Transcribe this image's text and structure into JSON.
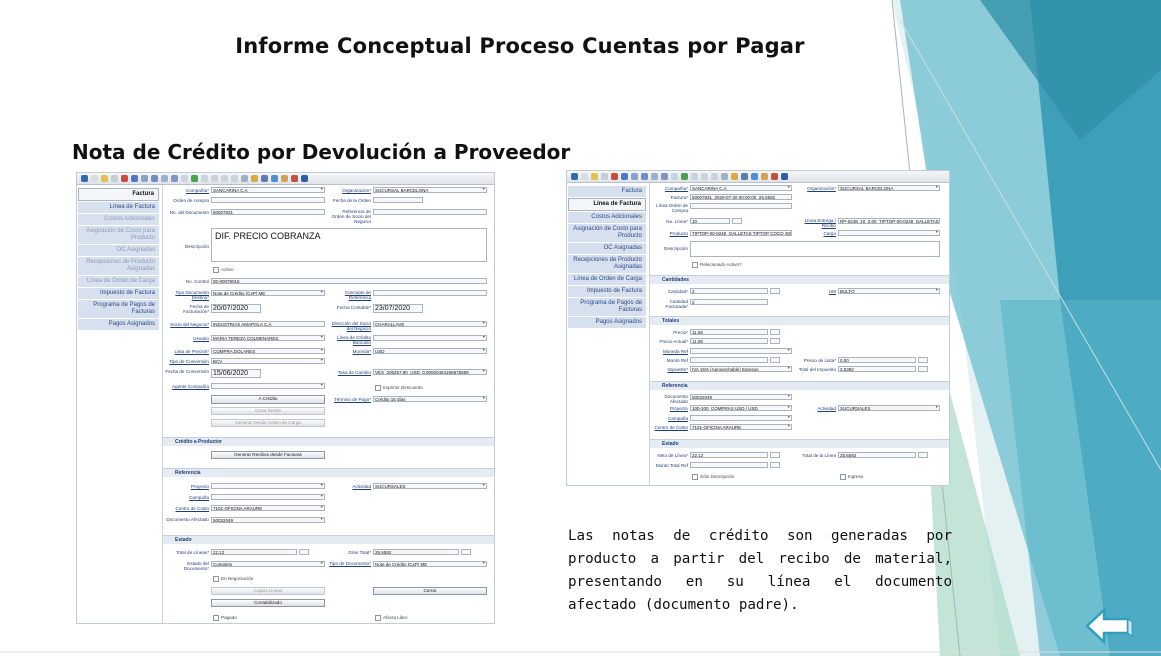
{
  "slide": {
    "title": "Informe Conceptual Proceso Cuentas por Pagar",
    "subtitle": "Nota de Crédito por Devolución a Proveedor",
    "description": "Las notas de crédito son generadas por producto a partir del recibo de material, presentando en su línea el documento afectado (documento padre).",
    "colors": {
      "teal_dark": "#2f8fa6",
      "teal_mid": "#4aa9bf",
      "teal_light": "#8fd0dc",
      "green_light": "#a9d8c6",
      "arrow": "#2f9fc0"
    },
    "back_icon": "left-arrow-icon"
  },
  "left_shot": {
    "sidebar": [
      "Factura",
      "Línea de Factura",
      "Costos Adicionales",
      "Asignación de Costo para Producto",
      "OC Asignadas",
      "Recepciones de Producto Asignadas",
      "Línea de Orden de Carga",
      "Impuesto de Factura",
      "Programa de Pagos de Facturas",
      "Pagos Asignados"
    ],
    "header": {
      "compania_label": "Compañía*",
      "compania": "SANCARINA C.A",
      "organizacion_label": "Organización*",
      "organizacion": "SUCURSAL BARCELONA",
      "orden_compra_label": "Orden de compra",
      "fecha_orden_label": "Fecha de la Orden",
      "no_documento_label": "No. del Documento",
      "no_documento": "50007931",
      "ref_orden_label": "Referencia de Orden de Socio del Negocio",
      "descripcion_label": "Descripción",
      "descripcion": "DIF. PRECIO COBRANZA",
      "activo_label": "Activo",
      "no_control_label": "No. Control",
      "no_control": "00-00079016",
      "tipo_doc_destino_label": "Tipo Documento Destino*",
      "tipo_doc_destino": "Nota de Crédito (CxP) ME",
      "concepto_ref_label": "Concepto de Referencia",
      "fecha_facturacion_label": "Fecha de Facturación*",
      "fecha_facturacion": "20/07/2020",
      "fecha_contable_label": "Fecha Contable*",
      "fecha_contable": "23/07/2020",
      "socio_label": "Socio del Negocio*",
      "socio": "INDUSTRIAS AMAPOLA C.A",
      "direccion_label": "Dirección del Socio del Negocio",
      "direccion": "CHARALLAVE",
      "usuario_label": "Usuario",
      "usuario": "MARIA TEREZA COLMENARES",
      "linea_credito_label": "Línea de Crédito Bancario",
      "lista_precios_label": "Lista de Precios*",
      "lista_precios": "COMPRA DOLARES",
      "moneda_label": "Moneda*",
      "moneda": "USD",
      "tipo_conversion_label": "Tipo de Conversión",
      "tipo_conversion": "BCV",
      "fecha_conversion_label": "Fecha de Conversión",
      "fecha_conversion": "15/06/2020",
      "tasa_cambio_label": "Tasa de Cambio",
      "tasa_cambio": "VES_206257.90_USD_0.00000484196876559",
      "imprimir_descuento_label": "Imprimir Descuento",
      "agente_label": "Agente Compañía",
      "a_credito_btn": "A Crédito",
      "termino_pago_label": "Término de Pago*",
      "termino_pago": "Crédito 15 días",
      "crear_desde_btn": "Crear Desde",
      "generar_desde_oc_btn": "Generar Desde Orden de Carga"
    },
    "credito_section": {
      "title": "Crédito a Productor",
      "btn": "Generar Recibos desde Facturas"
    },
    "referencia_section": {
      "title": "Referencia",
      "proyecto_label": "Proyecto",
      "actividad_label": "Actividad",
      "actividad": "SUCURSALES",
      "campana_label": "Campaña",
      "centro_costo_label": "Centro de Costo",
      "centro_costo": "7101-OFICINA ARAURE",
      "doc_afectado_label": "Documento Afectado",
      "doc_afectado": "50032049"
    },
    "estado_section": {
      "title": "Estado",
      "total_lineas_label": "Total de Líneas*",
      "total_lineas": "22,12",
      "gran_total_label": "Gran Total*",
      "gran_total": "25,6592",
      "estado_doc_label": "Estado del Documento*",
      "estado_doc": "Completo",
      "tipo_doc_label": "Tipo de Documento*",
      "tipo_doc": "Nota de Crédito (CxP) ME",
      "negociacion_label": "En Negociación",
      "copiar_lineas_btn": "Copiar Líneas",
      "cerrar_btn": "Cerrar",
      "contabilizado_btn": "Contabilizado",
      "pagado_label": "Pagado",
      "afecta_libro_label": "Afecta Libro"
    }
  },
  "right_shot": {
    "sidebar": [
      "Factura",
      "Línea de Factura",
      "Costos Adicionales",
      "Asignación de Costo para Producto",
      "OC Asignadas",
      "Recepciones de Producto Asignadas",
      "Línea de Orden de Carga",
      "Impuesto de Factura",
      "Programa de Pagos de Facturas",
      "Pagos Asignados"
    ],
    "header": {
      "compania_label": "Compañía*",
      "compania": "SANCARINA C.A",
      "organizacion_label": "Organización*",
      "organizacion": "SUCURSAL BARCELONA",
      "factura_label": "Factura*",
      "factura": "50007931_2020-07-20 00:00:00_25,6592",
      "linea_orden_label": "Línea Orden de Compra",
      "no_linea_label": "No. Línea*",
      "no_linea": "10",
      "linea_entrega_label": "Línea Entrega / Recibo",
      "linea_entrega": "RP-0248_10_2.00_TIPTOP-00-0248_GALLETAS TIP",
      "producto_label": "Producto",
      "producto": "TIPTOP-00-0248_GALLETAS TIPTOP COCO 48X60",
      "cargo_label": "Cargo",
      "descripcion_label": "Descripción",
      "relacionado_label": "Relacionado Activo?"
    },
    "cantidades": {
      "title": "Cantidades",
      "cantidad_label": "Cantidad*",
      "cantidad": "2",
      "um_label": "UM",
      "um": "BULTO",
      "cant_fact_label": "Cantidad Facturada*",
      "cant_fact": "2"
    },
    "totales": {
      "title": "Totales",
      "precio_label": "Precio*",
      "precio": "11,06",
      "precio_actual_label": "Precio Actual*",
      "precio_actual": "11,06",
      "moneda_ref_label": "Moneda Ref",
      "monto_ref_label": "Monto Ref",
      "precio_lista_label": "Precio de Lista*",
      "precio_lista": "0,00",
      "impuesto_label": "Impuesto*",
      "impuesto": "IVA 16% (Aprovechable) Egresos",
      "total_impuesto_label": "Total del Impuesto",
      "total_impuesto": "3,5392"
    },
    "referencia": {
      "title": "Referencia",
      "doc_afectado_label": "Documento Afectado",
      "doc_afectado": "50032049",
      "proyecto_label": "Proyecto",
      "proyecto": "100-100_COMPRAS USD / USD",
      "actividad_label": "Actividad",
      "actividad": "SUCURSALES",
      "campana_label": "Campaña",
      "centro_costo_label": "Centro de Costo",
      "centro_costo": "7101-OFICINA ARAURE"
    },
    "estado": {
      "title": "Estado",
      "neto_linea_label": "Neto de Línea*",
      "neto_linea": "22,12",
      "total_linea_label": "Total de la Línea",
      "total_linea": "25,6592",
      "monto_total_ref_label": "Monto Total Ref",
      "solo_desc_label": "Sólo Descripción",
      "ingreso_label": "Ingreso"
    }
  }
}
